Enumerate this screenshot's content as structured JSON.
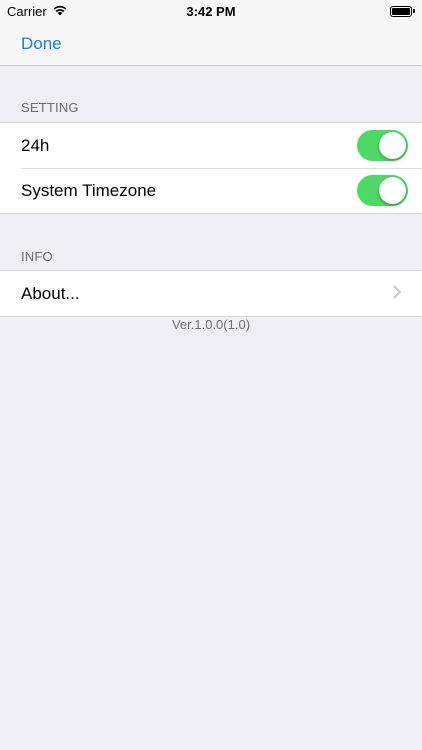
{
  "status_bar": {
    "carrier": "Carrier",
    "time": "3:42 PM",
    "icons": [
      "wifi-icon",
      "battery-icon"
    ]
  },
  "nav_bar": {
    "done_label": "Done",
    "accent_color": "#1a7cf5"
  },
  "sections": {
    "setting": {
      "header": "SETTING",
      "rows": [
        {
          "label": "24h",
          "toggle_on": true
        },
        {
          "label": "System Timezone",
          "toggle_on": true
        }
      ]
    },
    "info": {
      "header": "INFO",
      "rows": [
        {
          "label": "About...",
          "accessory": "chevron-right-icon"
        }
      ]
    }
  },
  "footer": {
    "version": "Ver.1.0.0(1.0)"
  },
  "colors": {
    "toggle_on": "#4cd964",
    "background": "#efeff4",
    "secondary_text": "#6d6d72"
  }
}
